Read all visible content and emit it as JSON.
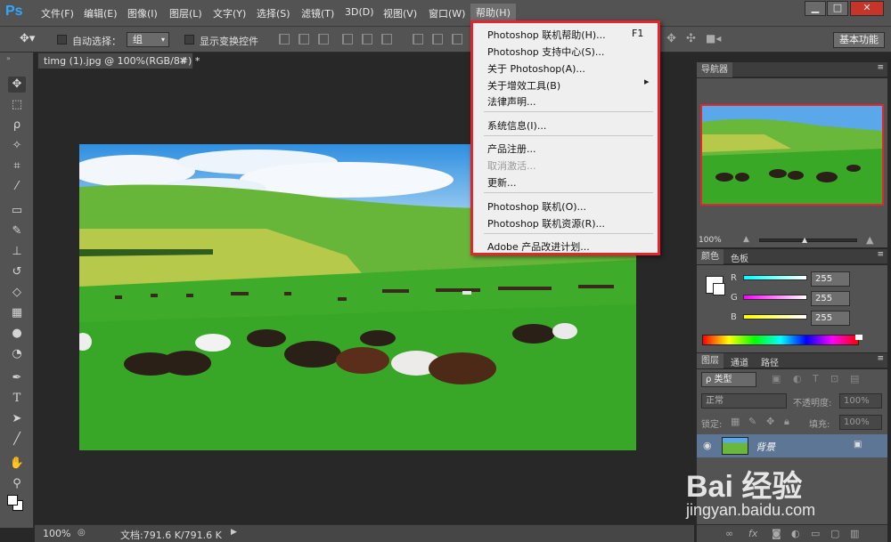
{
  "app": {
    "logo": "Ps"
  },
  "menubar": {
    "items": [
      "文件(F)",
      "编辑(E)",
      "图像(I)",
      "图层(L)",
      "文字(Y)",
      "选择(S)",
      "滤镜(T)",
      "3D(D)",
      "视图(V)",
      "窗口(W)",
      "帮助(H)"
    ],
    "window_controls": [
      "▁",
      "□",
      "✕"
    ]
  },
  "options": {
    "auto_select_label": "自动选择：",
    "group_value": "组",
    "show_transform_label": "显示变换控件",
    "workspace_label": "基本功能"
  },
  "document": {
    "tab_title": "timg (1).jpg @ 100%(RGB/8#) *",
    "tab_close": "×",
    "zoom": "100%",
    "doc_size": "文档:791.6 K/791.6 K"
  },
  "navigator": {
    "tab": "导航器",
    "zoom": "100%"
  },
  "color_panel": {
    "tabs": [
      "颜色",
      "色板"
    ],
    "channels": [
      {
        "label": "R",
        "value": "255"
      },
      {
        "label": "G",
        "value": "255"
      },
      {
        "label": "B",
        "value": "255"
      }
    ]
  },
  "layers_panel": {
    "tabs": [
      "图层",
      "通道",
      "路径"
    ],
    "filter_label": "ρ 类型",
    "blend_mode": "正常",
    "opacity_label": "不透明度:",
    "opacity_value": "100%",
    "lock_label": "锁定:",
    "fill_label": "填充:",
    "fill_value": "100%",
    "layer_name": "背景"
  },
  "help_menu": {
    "items": [
      {
        "label": "Photoshop 联机帮助(H)...",
        "shortcut": "F1",
        "enabled": true
      },
      {
        "label": "Photoshop 支持中心(S)...",
        "enabled": true
      },
      {
        "label": "关于 Photoshop(A)...",
        "enabled": true
      },
      {
        "label": "关于增效工具(B)",
        "submenu": "▸",
        "enabled": true
      },
      {
        "label": "法律声明...",
        "enabled": true
      },
      {
        "label": "系统信息(I)...",
        "enabled": true
      },
      {
        "label": "产品注册...",
        "enabled": true
      },
      {
        "label": "取消激活...",
        "enabled": false
      },
      {
        "label": "更新...",
        "enabled": true
      },
      {
        "label": "Photoshop 联机(O)...",
        "enabled": true
      },
      {
        "label": "Photoshop 联机资源(R)...",
        "enabled": true
      },
      {
        "label": "Adobe 产品改进计划...",
        "enabled": true
      }
    ]
  },
  "watermark": {
    "brand": "Bai 经验",
    "url": "jingyan.baidu.com"
  },
  "colors": {
    "accent_red": "#e3262e",
    "ps_blue": "#31a8ff",
    "menu_bg": "#535353"
  },
  "icons": [
    "move-tool-icon",
    "marquee-icon",
    "lasso-icon",
    "magic-wand-icon",
    "crop-icon",
    "eyedropper-icon",
    "healing-icon",
    "brush-icon",
    "stamp-icon",
    "history-brush-icon",
    "eraser-icon",
    "gradient-icon",
    "blur-icon",
    "dodge-icon",
    "pen-icon",
    "type-icon",
    "path-select-icon",
    "line-icon",
    "hand-icon",
    "zoom-icon"
  ]
}
